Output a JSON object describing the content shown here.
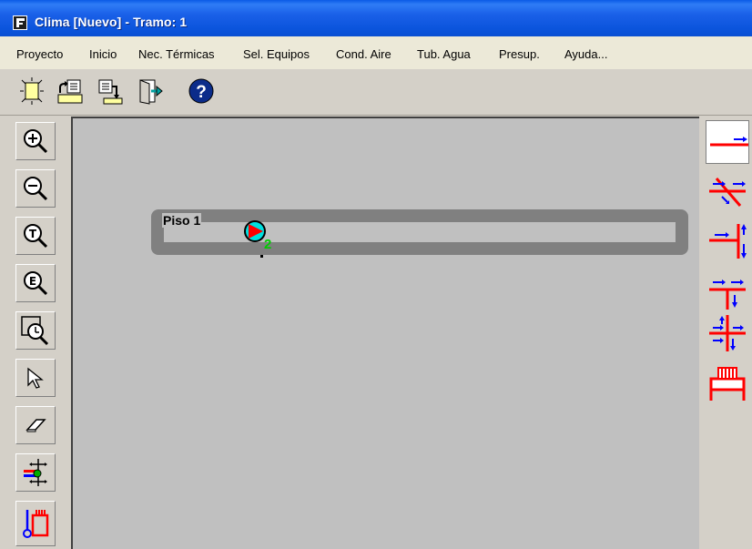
{
  "window": {
    "title": "Clima [Nuevo] - Tramo: 1",
    "icon": "app-f-icon"
  },
  "menu": [
    {
      "label": "Proyecto"
    },
    {
      "label": "Inicio"
    },
    {
      "label": "Nec. Térmicas"
    },
    {
      "label": "Sel. Equipos"
    },
    {
      "label": "Cond. Aire"
    },
    {
      "label": "Tub. Agua"
    },
    {
      "label": "Presup."
    },
    {
      "label": "Ayuda..."
    }
  ],
  "toolbar": [
    {
      "icon": "new-document-icon"
    },
    {
      "icon": "open-folder-icon"
    },
    {
      "icon": "save-document-icon"
    },
    {
      "icon": "exit-door-icon"
    },
    {
      "icon": "help-icon"
    }
  ],
  "left_tools": [
    {
      "icon": "zoom-in-icon"
    },
    {
      "icon": "zoom-out-icon"
    },
    {
      "icon": "zoom-total-icon"
    },
    {
      "icon": "zoom-extents-icon"
    },
    {
      "icon": "zoom-window-icon"
    },
    {
      "icon": "select-pointer-icon"
    },
    {
      "icon": "eraser-icon"
    },
    {
      "icon": "move-node-icon"
    },
    {
      "icon": "radiator-connection-icon"
    }
  ],
  "right_tools": [
    {
      "icon": "pipe-segment-icon",
      "active": true
    },
    {
      "icon": "pipe-cross-diagonal-icon",
      "active": false
    },
    {
      "icon": "pipe-tee-right-icon",
      "active": false
    },
    {
      "icon": "pipe-tee-down-icon",
      "active": false
    },
    {
      "icon": "pipe-cross-icon",
      "active": false
    },
    {
      "icon": "radiator-icon",
      "active": false
    }
  ],
  "canvas": {
    "floor_label": "Piso 1",
    "pump_node_number": "2"
  },
  "colors": {
    "title_bar": "#0a54dc",
    "canvas_background": "#c0c0c0",
    "floor_band": "#808080",
    "node_number": "#00cc00",
    "pipe_red": "#ff0000",
    "pipe_blue": "#0000ff"
  }
}
